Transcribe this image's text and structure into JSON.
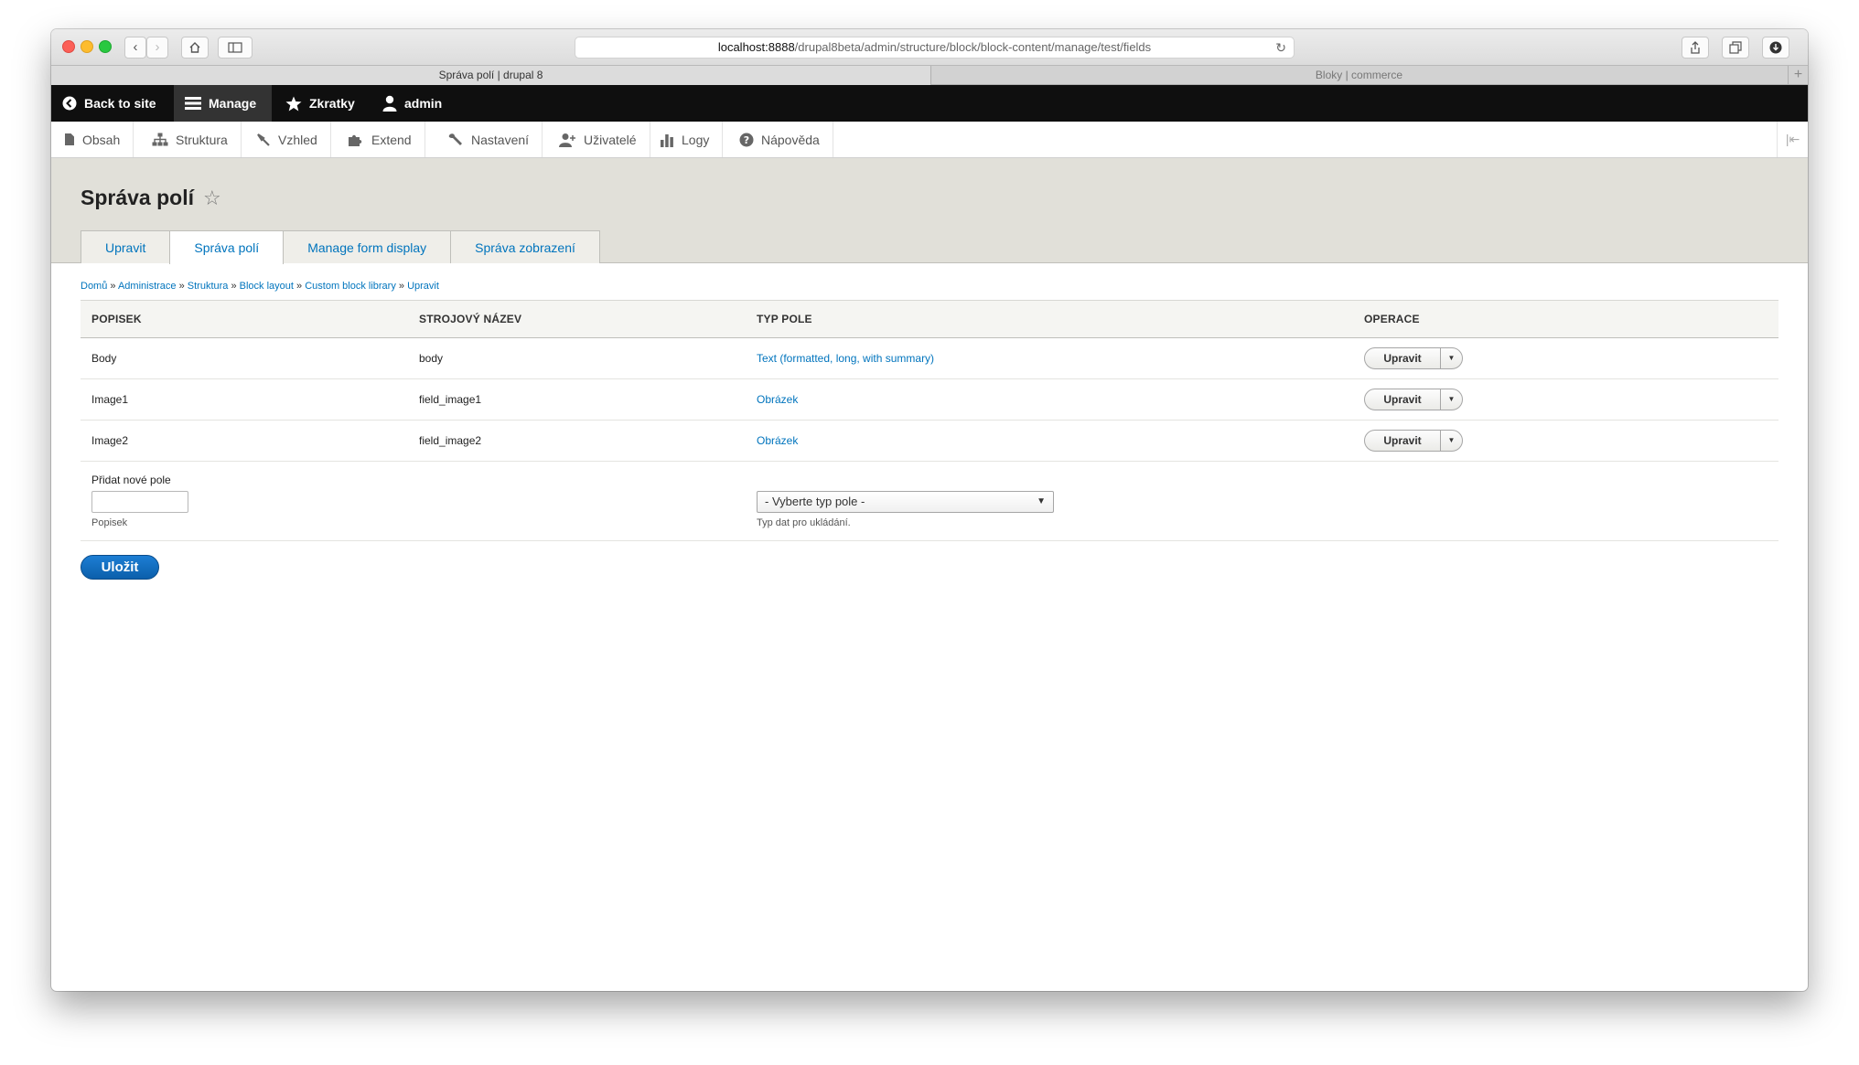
{
  "browser": {
    "url_host": "localhost:8888",
    "url_path": "/drupal8beta/admin/structure/block/block-content/manage/test/fields",
    "tabs": [
      {
        "label": "Správa polí | drupal 8"
      },
      {
        "label": "Bloky | commerce"
      }
    ]
  },
  "admin_bar": {
    "back_to_site": "Back to site",
    "manage": "Manage",
    "shortcuts": "Zkratky",
    "user": "admin"
  },
  "tray": {
    "items": [
      "Obsah",
      "Struktura",
      "Vzhled",
      "Extend",
      "Nastavení",
      "Uživatelé",
      "Logy",
      "Nápověda"
    ]
  },
  "page": {
    "title": "Správa polí",
    "tabs": [
      "Upravit",
      "Správa polí",
      "Manage form display",
      "Správa zobrazení"
    ]
  },
  "breadcrumb": [
    "Domů",
    "Administrace",
    "Struktura",
    "Block layout",
    "Custom block library",
    "Upravit"
  ],
  "table": {
    "headers": [
      "POPISEK",
      "STROJOVÝ NÁZEV",
      "TYP POLE",
      "OPERACE"
    ],
    "rows": [
      {
        "label": "Body",
        "machine": "body",
        "type": "Text (formatted, long, with summary)",
        "op": "Upravit"
      },
      {
        "label": "Image1",
        "machine": "field_image1",
        "type": "Obrázek",
        "op": "Upravit"
      },
      {
        "label": "Image2",
        "machine": "field_image2",
        "type": "Obrázek",
        "op": "Upravit"
      }
    ],
    "add_new": {
      "title": "Přidat nové pole",
      "label_help": "Popisek",
      "select_value": "- Vyberte typ pole -",
      "select_help": "Typ dat pro ukládání."
    }
  },
  "save_label": "Uložit",
  "colors": {
    "link": "#0074bd",
    "primary_button": "#0b5fab",
    "header_bg": "#e1e0d9"
  }
}
